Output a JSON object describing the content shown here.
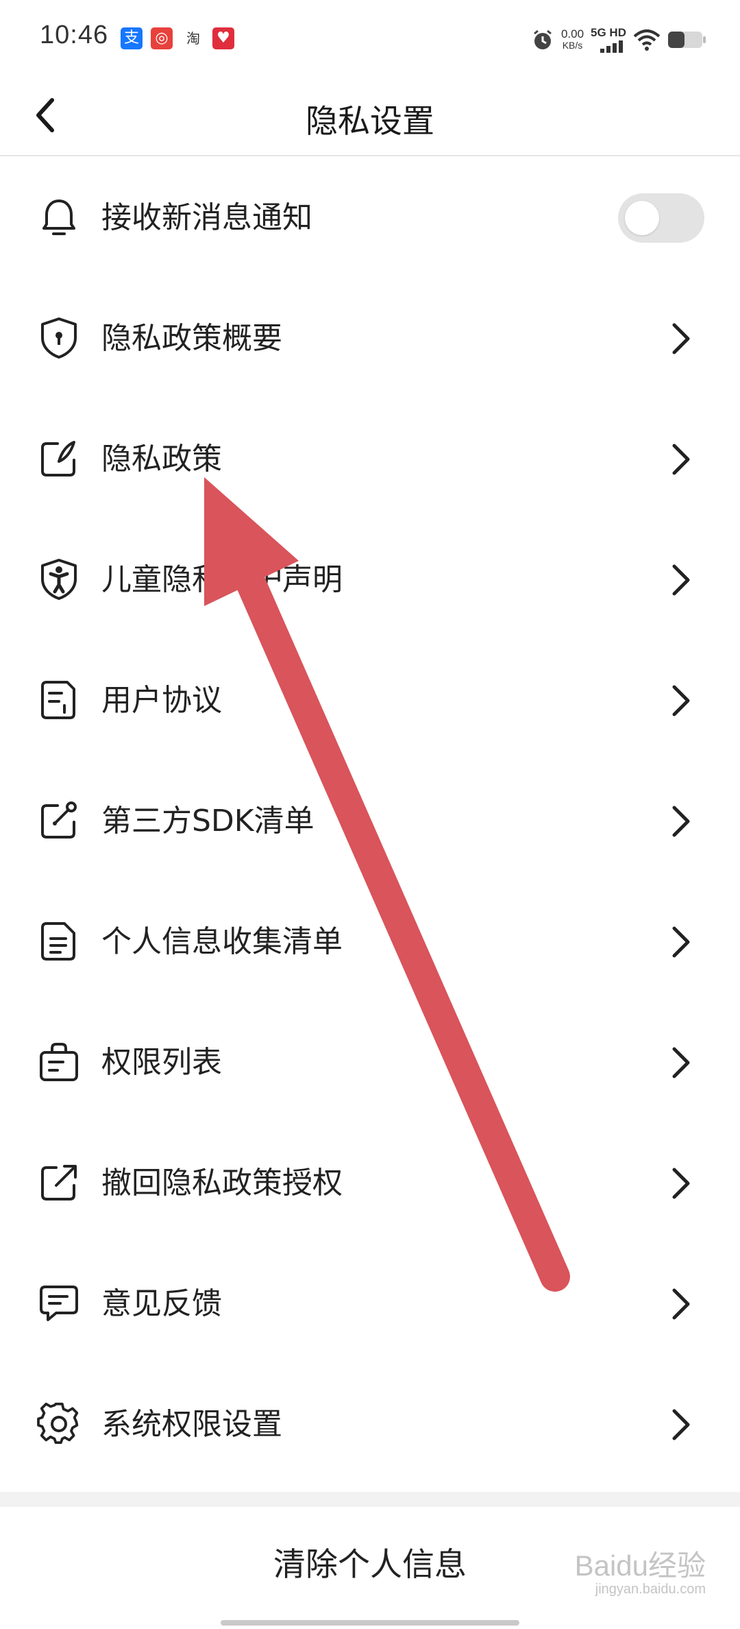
{
  "status_bar": {
    "time": "10:46",
    "speed_value": "0.00",
    "speed_unit": "KB/s",
    "network": "5G HD",
    "app_icons": [
      "alipay-icon",
      "camera-app-icon",
      "taobao-icon",
      "heart-app-icon"
    ],
    "taobao_glyph": "淘"
  },
  "header": {
    "title": "隐私设置"
  },
  "settings": {
    "items": [
      {
        "label": "接收新消息通知",
        "icon": "bell-icon",
        "control": "toggle",
        "toggle_on": false
      },
      {
        "label": "隐私政策概要",
        "icon": "shield-keyhole-icon",
        "control": "chevron"
      },
      {
        "label": "隐私政策",
        "icon": "edit-note-icon",
        "control": "chevron"
      },
      {
        "label": "儿童隐私保护声明",
        "icon": "child-shield-icon",
        "control": "chevron"
      },
      {
        "label": "用户协议",
        "icon": "document-icon",
        "control": "chevron"
      },
      {
        "label": "第三方SDK清单",
        "icon": "sdk-edit-icon",
        "control": "chevron"
      },
      {
        "label": "个人信息收集清单",
        "icon": "file-list-icon",
        "control": "chevron"
      },
      {
        "label": "权限列表",
        "icon": "bag-list-icon",
        "control": "chevron"
      },
      {
        "label": "撤回隐私政策授权",
        "icon": "external-arrow-icon",
        "control": "chevron"
      },
      {
        "label": "意见反馈",
        "icon": "feedback-icon",
        "control": "chevron"
      },
      {
        "label": "系统权限设置",
        "icon": "gear-icon",
        "control": "chevron"
      }
    ]
  },
  "footer": {
    "clear_label": "清除个人信息"
  },
  "watermark": {
    "text": "Baidu经验",
    "url": "jingyan.baidu.com"
  },
  "colors": {
    "annotation_arrow": "#d9545b",
    "toggle_off": "#e3e3e3",
    "divider": "#e6e6e6"
  }
}
